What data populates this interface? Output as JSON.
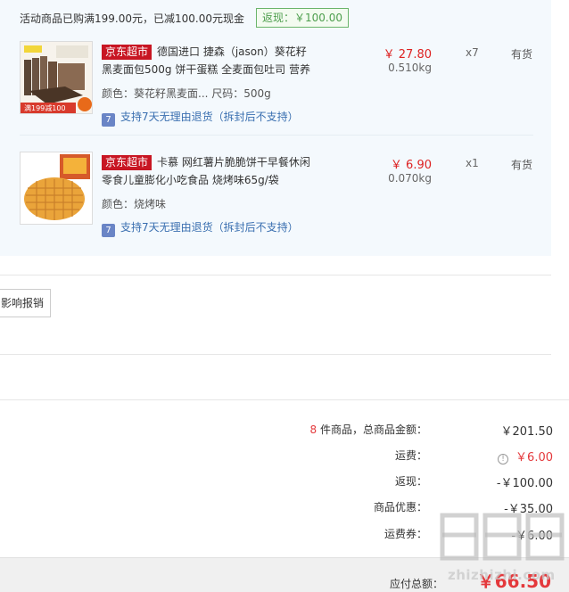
{
  "promo": {
    "header": "活动商品已购满199.00元，已减100.00元现金",
    "discount": "返现：￥100.00"
  },
  "items": [
    {
      "badge": "京东超市",
      "title1": "德国进口 捷森（jason）葵花籽",
      "title2": "黑麦面包500g 饼干蛋糕 全麦面包吐司 营养",
      "attrs": "颜色：葵花籽黑麦面...  尺码：500g",
      "service": "支持7天无理由退货（拆封后不支持）",
      "price": "￥ 27.80",
      "weight": "0.510kg",
      "qty": "x7",
      "stock": "有货",
      "thumb_text": "满199减100"
    },
    {
      "badge": "京东超市",
      "title1": "卡慕 网红薯片脆脆饼干早餐休闲",
      "title2": "零食儿童膨化小吃食品 烧烤味65g/袋",
      "attrs": "颜色：烧烤味",
      "service": "支持7天无理由退货（拆封后不支持）",
      "price": "￥ 6.90",
      "weight": "0.070kg",
      "qty": "x1",
      "stock": "有货"
    }
  ],
  "invoice_button": "影响报销",
  "summary": {
    "count": "8",
    "count_suffix": " 件商品，总商品金额：",
    "total_goods": "￥201.50",
    "shipping_label": "运费：",
    "shipping": "￥6.00",
    "cashback_label": "返现：",
    "cashback": "-￥100.00",
    "discount_label": "商品优惠：",
    "discount": "-￥35.00",
    "coupon_label": "运费券：",
    "coupon": "-￥6.00",
    "payable_label": "应付总额：",
    "payable": "￥66.50"
  },
  "watermark": "zhizhizhi.com",
  "colors": {
    "accent": "#e4393c",
    "badge": "#c81623",
    "link": "#3a6fb0"
  }
}
